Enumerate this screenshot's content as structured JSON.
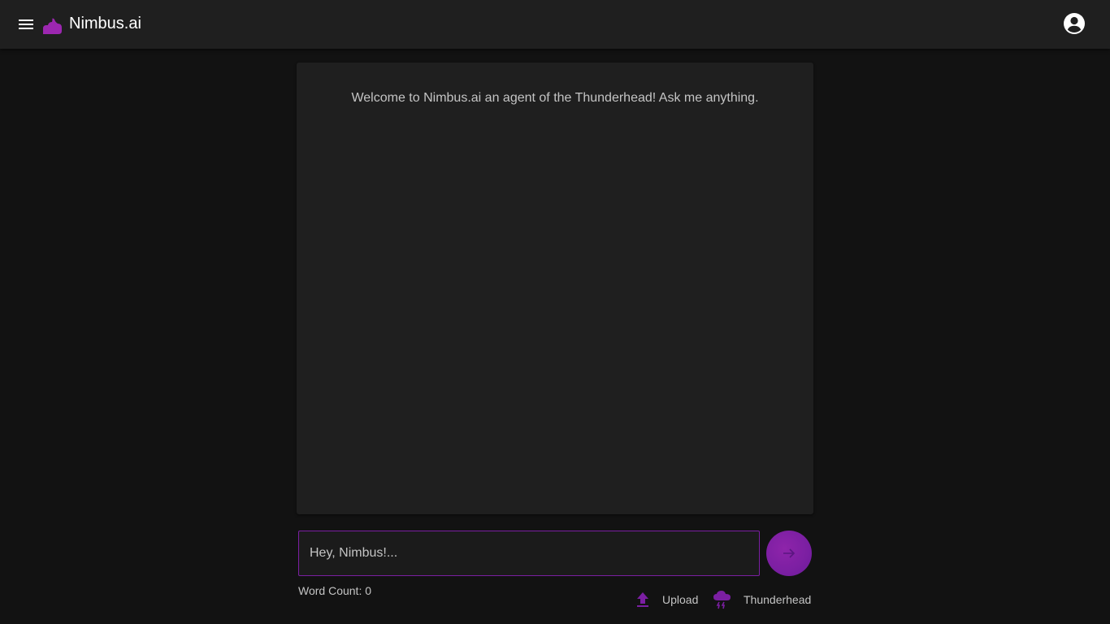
{
  "app": {
    "brand": "Nimbus.ai",
    "accent_color": "#9c27b0",
    "background_color": "#121212",
    "surface_color": "#1f1f1f"
  },
  "header": {
    "menu_icon": "hamburger-menu-icon",
    "logo_icon": "cloud-icon",
    "account_icon": "account-circle-icon"
  },
  "chat": {
    "welcome_message": "Welcome to Nimbus.ai an agent of the Thunderhead! Ask me anything."
  },
  "composer": {
    "input_placeholder": "Hey, Nimbus!...",
    "input_value": "",
    "send_icon": "arrow-right-icon",
    "word_count_label": "Word Count: 0"
  },
  "actions": {
    "upload_label": "Upload",
    "upload_icon": "upload-icon",
    "thunderhead_label": "Thunderhead",
    "thunderhead_icon": "thunderstorm-cloud-icon"
  }
}
